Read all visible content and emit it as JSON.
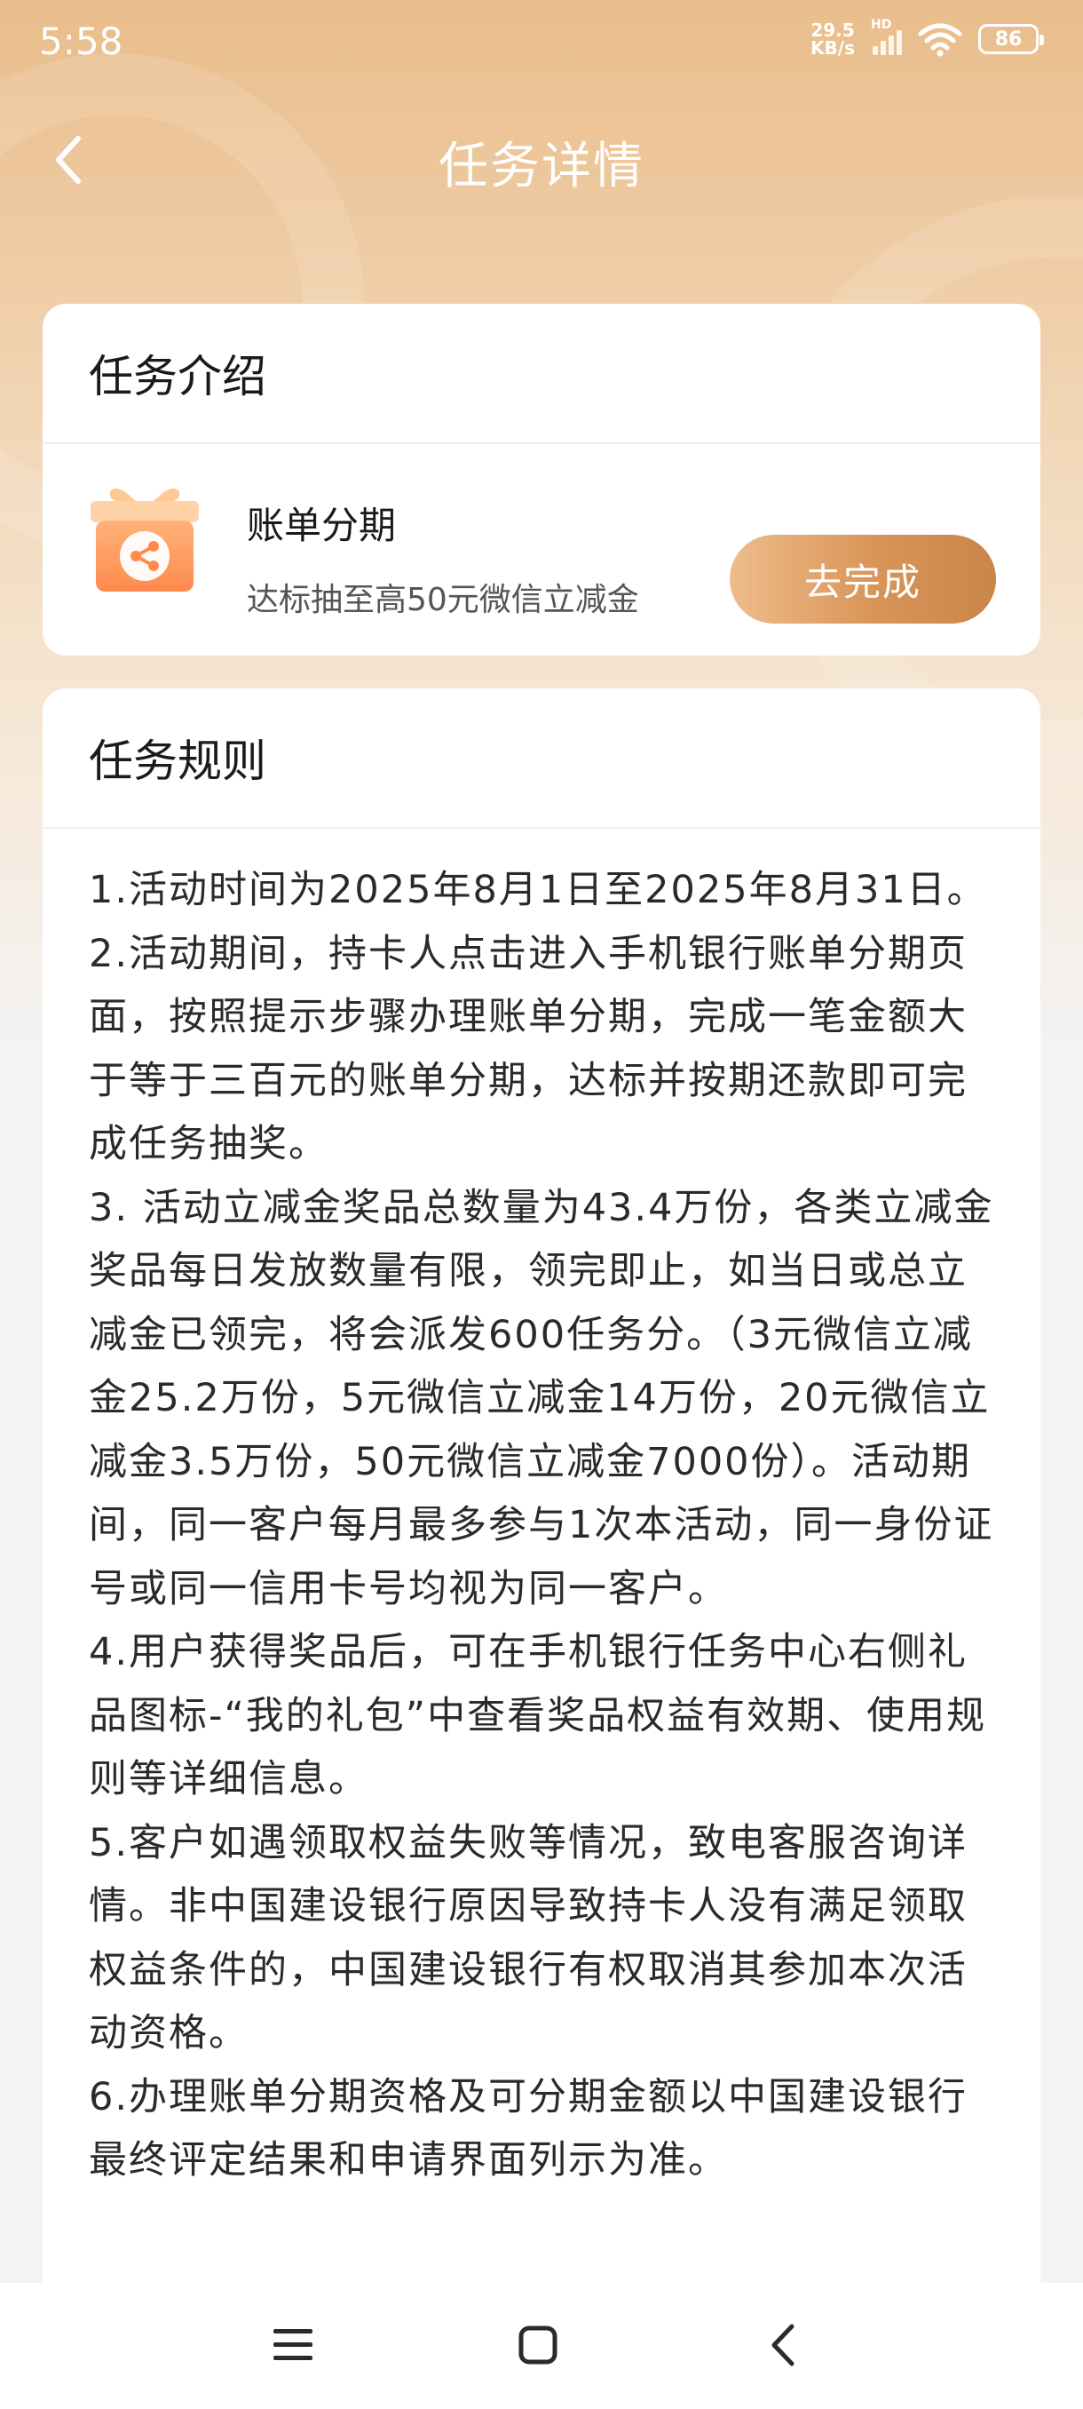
{
  "status_bar": {
    "time": "5:58",
    "net_speed_value": "29.5",
    "net_speed_unit": "KB/s",
    "hd_label": "HD",
    "battery_level": "86"
  },
  "header": {
    "title": "任务详情",
    "back_icon": "chevron-left-icon"
  },
  "intro_card": {
    "title": "任务介绍",
    "task": {
      "icon": "gift-share-icon",
      "name": "账单分期",
      "description": "达标抽至高50元微信立减金",
      "button_label": "去完成"
    }
  },
  "rules_card": {
    "title": "任务规则",
    "paragraphs": [
      "1.活动时间为2025年8月1日至2025年8月31日。",
      "2.活动期间，持卡人点击进入手机银行账单分期页面，按照提示步骤办理账单分期，完成一笔金额大于等于三百元的账单分期，达标并按期还款即可完成任务抽奖。",
      "3. 活动立减金奖品总数量为43.4万份，各类立减金奖品每日发放数量有限，领完即止，如当日或总立减金已领完，将会派发600任务分。（3元微信立减金25.2万份，5元微信立减金14万份，20元微信立减金3.5万份，50元微信立减金7000份）。活动期间，同一客户每月最多参与1次本活动，同一身份证号或同一信用卡号均视为同一客户。",
      "4.用户获得奖品后，可在手机银行任务中心右侧礼品图标-“我的礼包”中查看奖品权益有效期、使用规则等详细信息。",
      "5.客户如遇领取权益失败等情况，致电客服咨询详情。非中国建设银行原因导致持卡人没有满足领取权益条件的，中国建设银行有权取消其参加本次活动资格。",
      "6.办理账单分期资格及可分期金额以中国建设银行最终评定结果和申请界面列示为准。"
    ]
  },
  "nav_bar": {
    "menu_icon": "menu-icon",
    "home_icon": "home-square-icon",
    "back_icon": "back-chevron-icon"
  },
  "colors": {
    "accent_start": "#eebc8b",
    "accent_end": "#c9854a",
    "header_bg": "#e9bd8b",
    "page_bg": "#f3f3f3"
  }
}
